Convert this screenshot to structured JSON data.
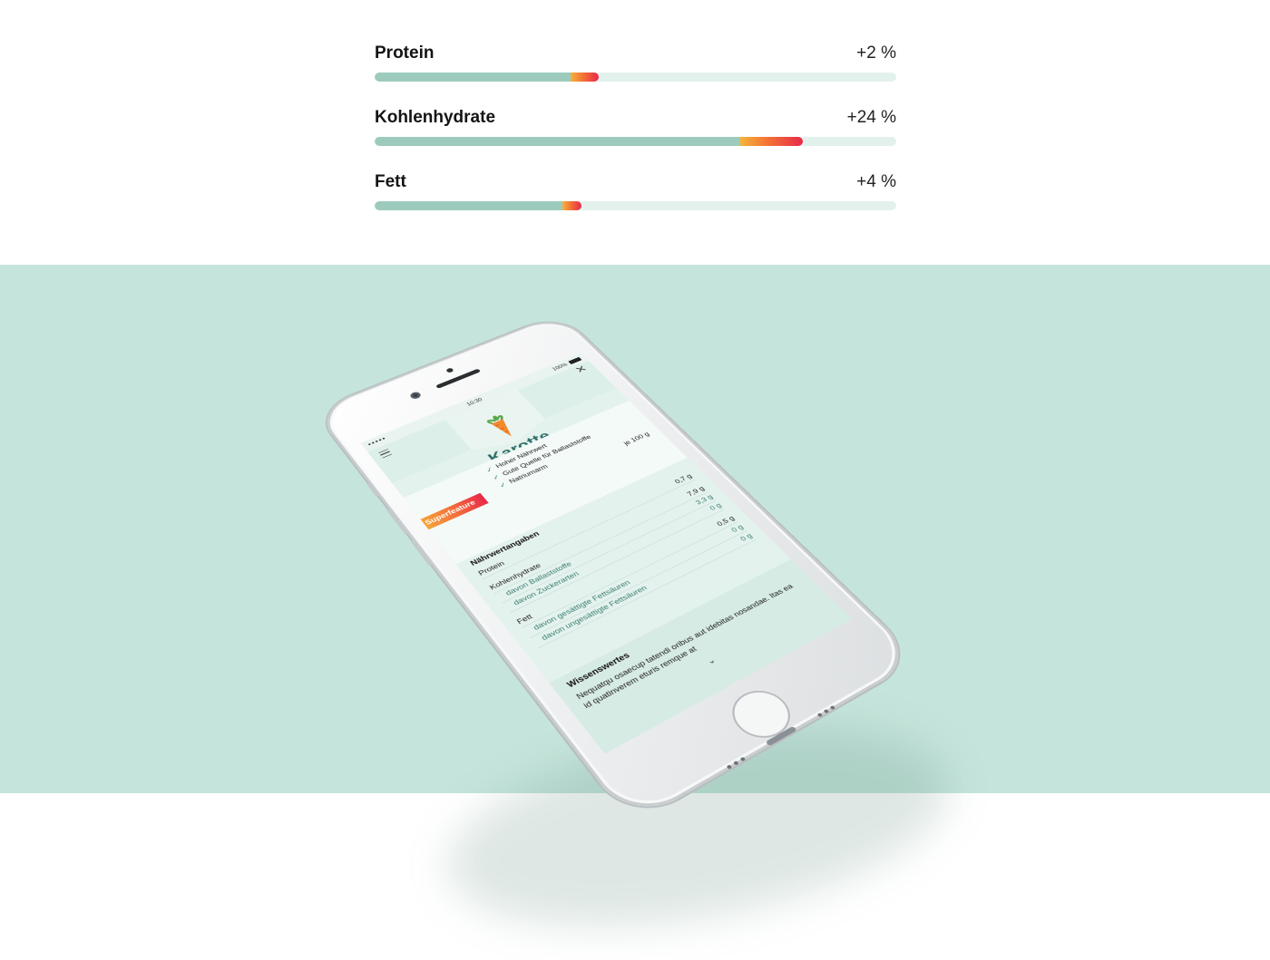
{
  "stats": [
    {
      "label": "Protein",
      "delta": "+2 %",
      "base": 0.375,
      "increase": 0.055
    },
    {
      "label": "Kohlenhydrate",
      "delta": "+24 %",
      "base": 0.7,
      "increase": 0.12
    },
    {
      "label": "Fett",
      "delta": "+4 %",
      "base": 0.36,
      "increase": 0.037
    }
  ],
  "colors": {
    "background_top": "#ffffff",
    "stage": "#c5e4db",
    "bar_base": "#9ccbbd",
    "bar_track": "#e3f1ed",
    "bar_increase_start": "#f6b23b",
    "bar_increase_end": "#e8294a",
    "title": "#2f6f66"
  },
  "phone": {
    "status": {
      "signal": "●●●●● ",
      "time": "10:30",
      "battery": "100%"
    },
    "header": {
      "title": "Karotte",
      "icon": "carrot-icon",
      "menu_icon": "menu-icon",
      "close_icon": "close-icon"
    },
    "badge": "Superfeature",
    "features": [
      "Hoher Nährwert",
      "Gute Quelle für Ballaststoffe",
      "Natriumarm"
    ],
    "per_label": "je 100 g",
    "nutrition": {
      "title": "Nährwertangaben",
      "rows": [
        {
          "label": "Protein",
          "value": "0,7 g",
          "sub": false
        },
        {
          "label": "Kohlenhydrate",
          "value": "7,9 g",
          "sub": false
        },
        {
          "label": "davon Ballaststoffe",
          "value": "3,3 g",
          "sub": true
        },
        {
          "label": "davon Zuckerarten",
          "value": "0 g",
          "sub": true
        },
        {
          "label": "Fett",
          "value": "0,5 g",
          "sub": false
        },
        {
          "label": "davon gesättigte Fettsäuren",
          "value": "0 g",
          "sub": true
        },
        {
          "label": "davon ungesättigte Fettsäuren",
          "value": "0 g",
          "sub": true
        }
      ]
    },
    "knowledge": {
      "title": "Wissenswertes",
      "text": "Nequatqu osaecup tatendi oribus aut idebitas nosandae. Itas ea id quatinverem eturis remque at"
    }
  }
}
